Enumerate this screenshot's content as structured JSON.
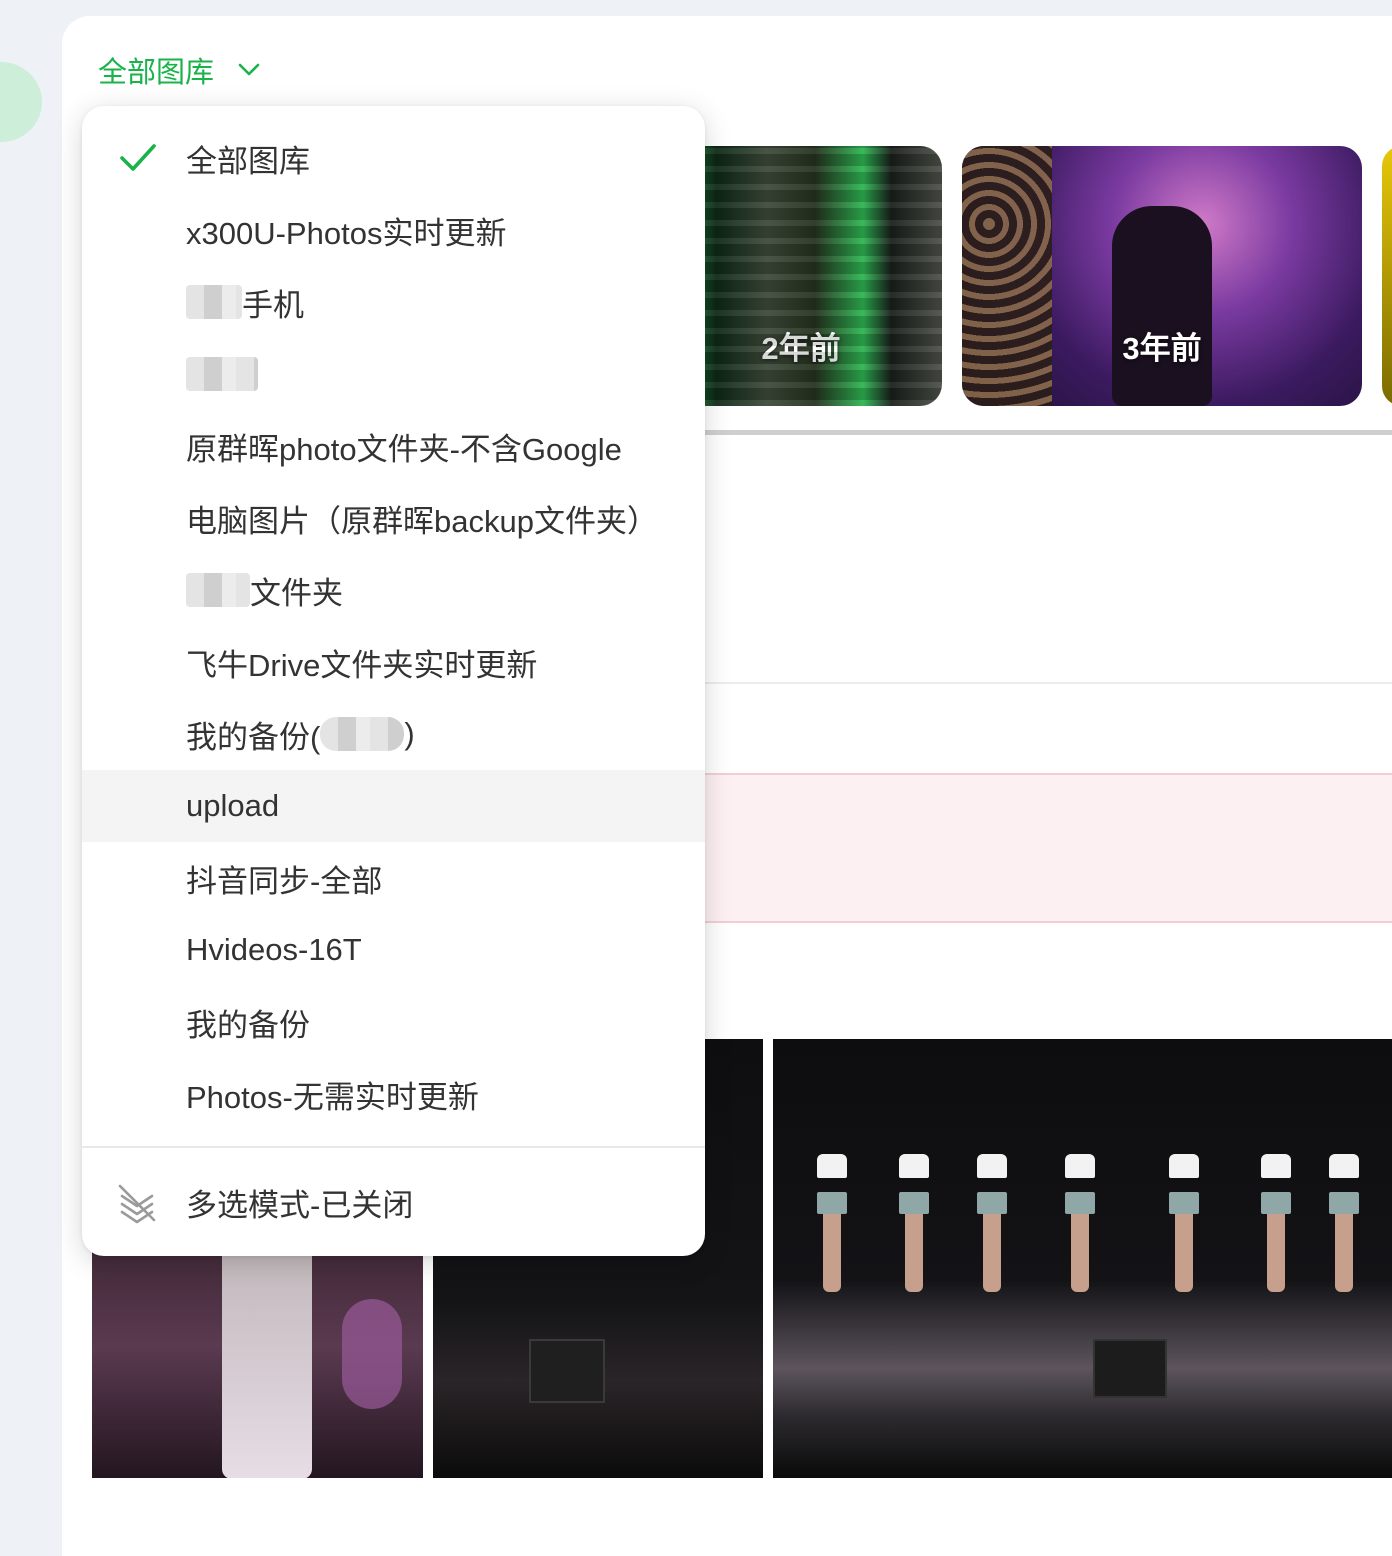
{
  "library_selector": {
    "label": "全部图库",
    "icon": "chevron-down-icon",
    "accent": "#19b34a"
  },
  "memory_cards": [
    {
      "age": "2年前"
    },
    {
      "age": "3年前"
    }
  ],
  "dropdown": {
    "selected_index": 0,
    "items": [
      {
        "label": "全部图库",
        "selected": true
      },
      {
        "label": "x300U-Photos实时更新"
      },
      {
        "label": "手机",
        "redacted_prefix": true
      },
      {
        "label": "",
        "redacted_only": true
      },
      {
        "label": "原群晖photo文件夹-不含Google"
      },
      {
        "label": "电脑图片（原群晖backup文件夹）"
      },
      {
        "label": "文件夹",
        "redacted_prefix": true
      },
      {
        "label": "飞牛Drive文件夹实时更新"
      },
      {
        "label": "我的备份(",
        "suffix": ")",
        "redacted_middle": true
      },
      {
        "label": "upload",
        "hovered": true
      },
      {
        "label": "抖音同步-全部"
      },
      {
        "label": "Hvideos-16T"
      },
      {
        "label": "我的备份"
      },
      {
        "label": "Photos-无需实时更新"
      }
    ],
    "multi_select": {
      "label": "多选模式-已关闭",
      "icon": "multi-select-off-icon"
    }
  }
}
